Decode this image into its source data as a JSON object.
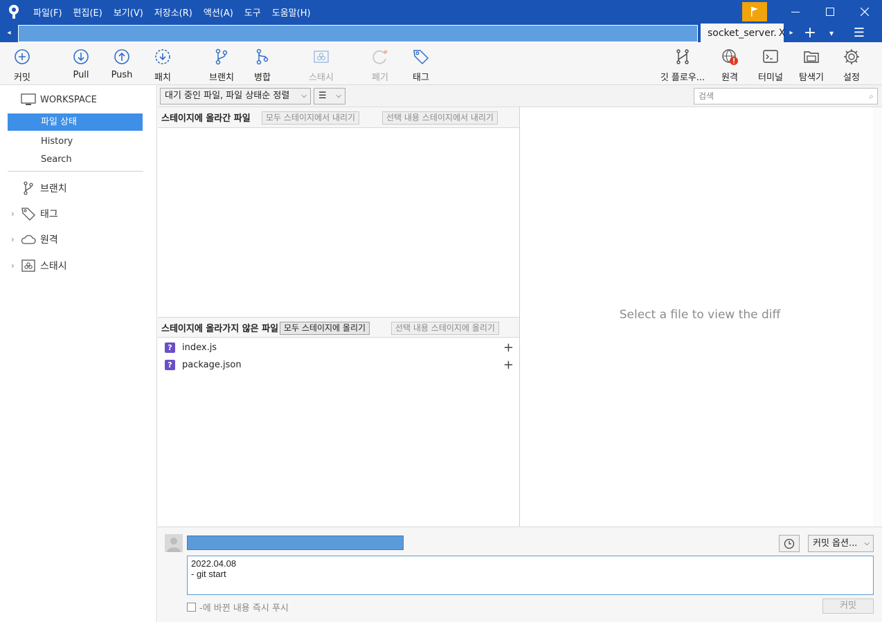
{
  "menu": [
    "파일(F)",
    "편집(E)",
    "보기(V)",
    "저장소(R)",
    "액션(A)",
    "도구",
    "도움말(H)"
  ],
  "window_controls": {
    "minimize": "—",
    "maximize": "☐",
    "close": "✕"
  },
  "tabs": {
    "active_label": "socket_server.",
    "close_glyph": "X",
    "add_glyph": "+",
    "dropdown_glyph": "▾",
    "menu_glyph": "☰",
    "left_arrow": "◂",
    "right_arrow": "▸"
  },
  "toolbar": {
    "commit": "커밋",
    "pull": "Pull",
    "push": "Push",
    "patch": "패치",
    "branch": "브랜치",
    "merge": "병합",
    "stash": "스태시",
    "discard": "폐기",
    "tag": "태그",
    "git_flow": "깃 플로우...",
    "remote": "원격",
    "terminal": "터미널",
    "explorer": "탐색기",
    "settings": "설정"
  },
  "sidebar": {
    "workspace": "WORKSPACE",
    "file_status": "파일 상태",
    "history": "History",
    "search": "Search",
    "groups": {
      "branches": "브랜치",
      "tags": "태그",
      "remotes": "원격",
      "stashes": "스태시"
    }
  },
  "filter": {
    "sort_label": "대기 중인 파일, 파일 상태순 정렬",
    "view_glyph": "☰",
    "search_placeholder": "검색"
  },
  "staged": {
    "title": "스테이지에 올라간 파일",
    "unstage_all": "모두 스테이지에서 내리기",
    "unstage_selected": "선택 내용 스테이지에서 내리기"
  },
  "unstaged": {
    "title": "스테이지에 올라가지 않은 파일",
    "stage_all": "모두 스테이지에 올리기",
    "stage_selected": "선택 내용 스테이지에 올리기",
    "files": [
      {
        "name": "index.js",
        "status": "?"
      },
      {
        "name": "package.json",
        "status": "?"
      }
    ],
    "add_glyph": "+"
  },
  "diff": {
    "placeholder": "Select a file to view the diff"
  },
  "commit": {
    "message_line1": "2022.04.08",
    "message_line2": "- git start",
    "options": "커밋 옵션...",
    "push_immediately": "-에 바뀐 내용 즉시 푸시",
    "commit_button": "커밋"
  },
  "colors": {
    "titlebar": "#1a55b6",
    "accent": "#3d8fe8",
    "flag": "#f0a30a",
    "untracked": "#6a4fc6",
    "alert": "#e03a1e"
  }
}
